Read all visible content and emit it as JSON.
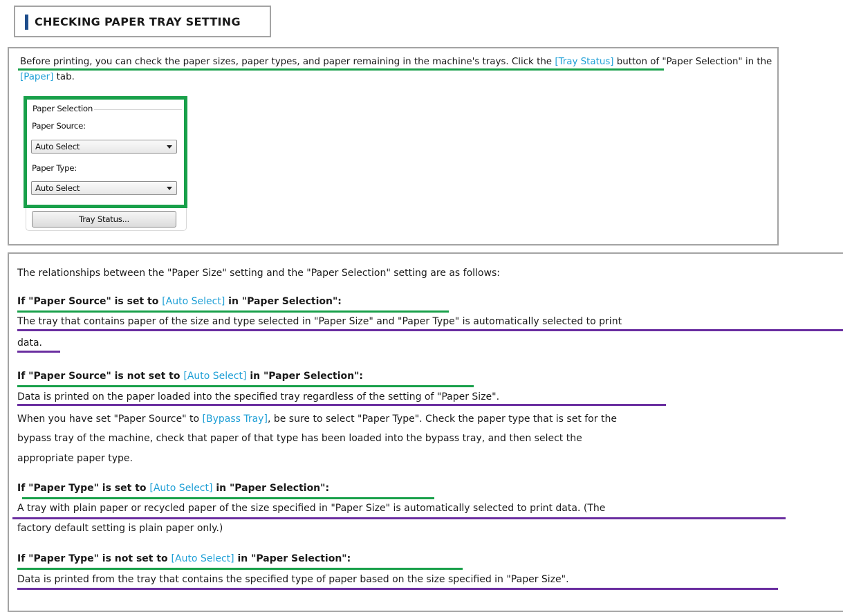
{
  "section_title": "CHECKING PAPER TRAY SETTING",
  "intro": {
    "part1": "Before printing, you can check the paper sizes, paper types, and paper remaining in the machine's trays. Click the ",
    "link_tray_status": "[Tray Status]",
    "part2": " button of \"Paper Selection\" in the ",
    "link_paper": "[Paper]",
    "part3": " tab."
  },
  "dialog": {
    "group_label": "Paper Selection",
    "paper_source_label": "Paper Source:",
    "paper_source_value": "Auto Select",
    "paper_type_label": "Paper Type:",
    "paper_type_value": "Auto Select",
    "tray_status_button": "Tray Status..."
  },
  "relationship_intro": "The relationships between the \"Paper Size\" setting and the \"Paper Selection\" setting are as follows:",
  "cases": [
    {
      "head_a": "If \"Paper Source\" is set to ",
      "head_link": "[Auto Select]",
      "head_b": " in \"Paper Selection\":",
      "line1": "The tray that contains paper of the size and type selected in \"Paper Size\" and \"Paper Type\" is automatically selected to print",
      "line2": "data."
    },
    {
      "head_a": "If \"Paper Source\" is not set to ",
      "head_link": "[Auto Select]",
      "head_b": " in \"Paper Selection\":",
      "line1": "Data is printed on the paper loaded into the specified tray regardless of the setting of \"Paper Size\".",
      "line2a": "When you have set \"Paper Source\" to ",
      "line2_link": "[Bypass Tray]",
      "line2b": ", be sure to select \"Paper Type\". Check the paper type that is set for the",
      "line3": "bypass tray of the machine, check that paper of that type has been loaded into the bypass tray, and then select the",
      "line4": "appropriate paper type."
    },
    {
      "head_a": "If \"Paper Type\" is set to ",
      "head_link": "[Auto Select]",
      "head_b": " in \"Paper Selection\":",
      "line1": "A tray with plain paper or recycled paper of the size specified in \"Paper Size\" is automatically selected to print data. (The",
      "line2": "factory default setting is plain paper only.)"
    },
    {
      "head_a": "If \"Paper Type\" is not set to ",
      "head_link": "[Auto Select]",
      "head_b": " in \"Paper Selection\":",
      "line1": "Data is printed from the tray that contains the specified type of paper based on the size specified in \"Paper Size\"."
    }
  ],
  "colors": {
    "link": "#1e9fd6",
    "green_highlight": "#18a04a",
    "purple_highlight": "#6a2ea0",
    "title_accent": "#1f4e8c"
  }
}
